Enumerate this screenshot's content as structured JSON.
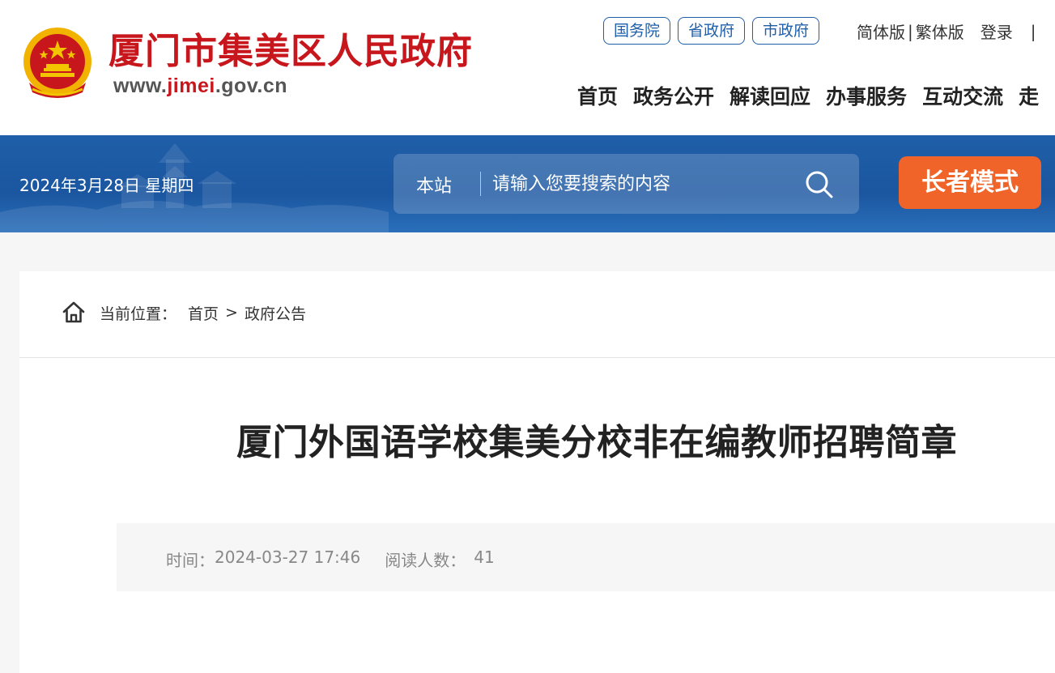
{
  "header": {
    "title": "厦门市集美区人民政府",
    "url_prefix": "www.",
    "url_highlight": "jimei",
    "url_suffix": ".gov.cn",
    "emblem_icon": "national-emblem-icon",
    "gov_links": [
      "国务院",
      "省政府",
      "市政府"
    ],
    "lang_simplified": "简体版",
    "lang_separator": "|",
    "lang_traditional": "繁体版",
    "login": "登录",
    "trailing_separator": "|",
    "nav": [
      "首页",
      "政务公开",
      "解读回应",
      "办事服务",
      "互动交流",
      "走"
    ]
  },
  "band": {
    "date": "2024年3月28日 星期四",
    "search_scope": "本站",
    "search_placeholder": "请输入您要搜索的内容",
    "search_icon": "search-icon",
    "elder_mode": "长者模式"
  },
  "breadcrumb": {
    "home_icon": "home-icon",
    "label": "当前位置：",
    "items": [
      "首页",
      "政府公告"
    ],
    "separator": ">"
  },
  "article": {
    "title": "厦门外国语学校集美分校非在编教师招聘简章",
    "time_label": "时间：",
    "time_value": "2024-03-27 17:46",
    "reads_label": "阅读人数：",
    "reads_value": "41"
  },
  "colors": {
    "brand_red": "#c8161d",
    "band_blue": "#1f5fa8",
    "elder_orange": "#f06429"
  }
}
